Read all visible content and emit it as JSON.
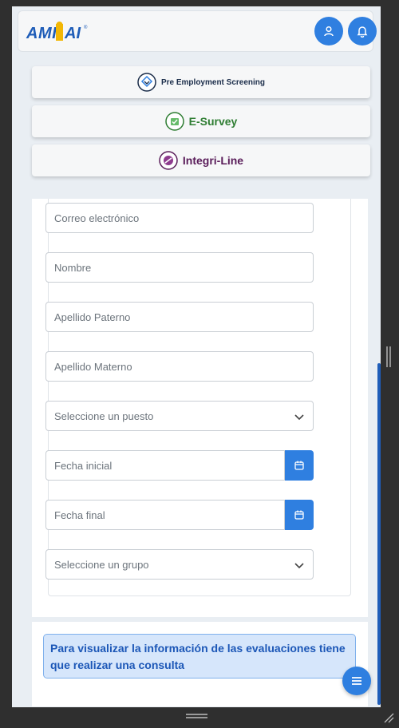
{
  "app": {
    "logo_text": "AMITAI",
    "account_icon": "user-icon",
    "notifications_icon": "bell-icon"
  },
  "modules": [
    {
      "label": "Pre Employment Screening",
      "icon": "pre-employment-screening-logo-icon"
    },
    {
      "label": "E-Survey",
      "icon": "e-survey-logo-icon"
    },
    {
      "label": "Integri-Line",
      "icon": "integri-line-logo-icon"
    }
  ],
  "form": {
    "email_placeholder": "Correo electrónico",
    "name_placeholder": "Nombre",
    "paternal_surname_placeholder": "Apellido Paterno",
    "maternal_surname_placeholder": "Apellido Materno",
    "position_select": "Seleccione un puesto",
    "start_date_placeholder": "Fecha inicial",
    "end_date_placeholder": "Fecha final",
    "group_select": "Seleccione un grupo"
  },
  "info": {
    "message": "Para visualizar la información de las evaluaciones tiene que realizar una consulta"
  },
  "colors": {
    "primary": "#2f7fe0",
    "alert_bg": "#d6e6fb",
    "alert_text": "#1c57b7",
    "page_bg": "#e9eef3"
  }
}
